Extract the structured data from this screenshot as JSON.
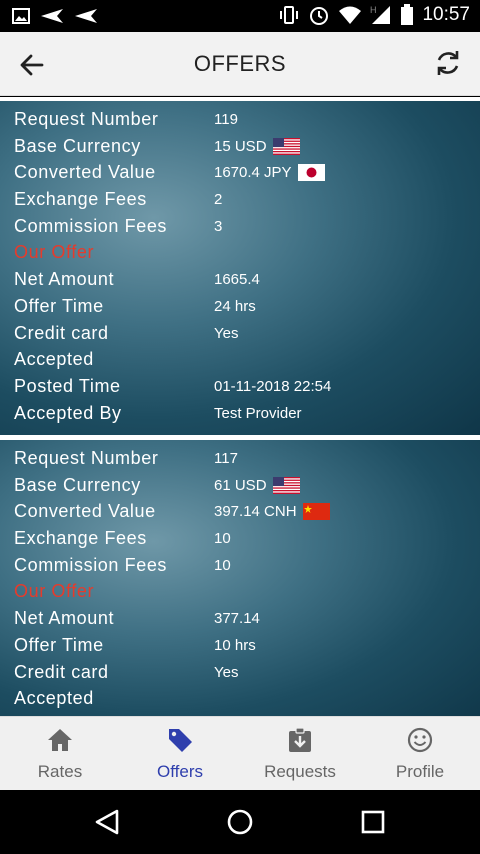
{
  "status_bar": {
    "time": "10:57"
  },
  "header": {
    "title": "OFFERS"
  },
  "offers": [
    {
      "rows": [
        {
          "label": "Request Number",
          "value": "119"
        },
        {
          "label": "Base Currency",
          "value": "15 USD",
          "flag": "us"
        },
        {
          "label": "Converted Value",
          "value": "1670.4 JPY",
          "flag": "jp"
        },
        {
          "label": "Exchange Fees",
          "value": "2"
        },
        {
          "label": "Commission Fees",
          "value": "3"
        },
        {
          "label": "Our Offer",
          "value": "",
          "highlight": true
        },
        {
          "label": "Net Amount",
          "value": "1665.4"
        },
        {
          "label": "Offer Time",
          "value": "24 hrs"
        },
        {
          "label": "Credit card",
          "value": "Yes"
        },
        {
          "label": "Accepted",
          "value": ""
        },
        {
          "label": "Posted Time",
          "value": "01-11-2018 22:54"
        },
        {
          "label": "Accepted By",
          "value": "Test Provider"
        }
      ]
    },
    {
      "rows": [
        {
          "label": "Request Number",
          "value": "117"
        },
        {
          "label": "Base Currency",
          "value": "61 USD",
          "flag": "us"
        },
        {
          "label": "Converted Value",
          "value": "397.14 CNH",
          "flag": "cn"
        },
        {
          "label": "Exchange Fees",
          "value": "10"
        },
        {
          "label": "Commission Fees",
          "value": "10"
        },
        {
          "label": "Our Offer",
          "value": "",
          "highlight": true
        },
        {
          "label": "Net Amount",
          "value": "377.14"
        },
        {
          "label": "Offer Time",
          "value": "10 hrs"
        },
        {
          "label": "Credit card",
          "value": "Yes"
        },
        {
          "label": "Accepted",
          "value": ""
        }
      ]
    }
  ],
  "bottom_nav": {
    "items": [
      {
        "label": "Rates",
        "icon": "home-icon",
        "active": false
      },
      {
        "label": "Offers",
        "icon": "tag-icon",
        "active": true
      },
      {
        "label": "Requests",
        "icon": "clipboard-download-icon",
        "active": false
      },
      {
        "label": "Profile",
        "icon": "smiley-icon",
        "active": false
      }
    ]
  },
  "colors": {
    "accent": "#2f3fad",
    "offer_red": "#e53b2c",
    "card_dark": "#1d4d61"
  }
}
